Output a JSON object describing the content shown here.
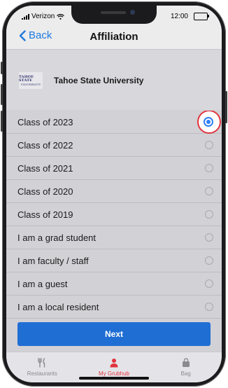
{
  "status_bar": {
    "carrier": "Verizon",
    "time": "12:00"
  },
  "nav": {
    "back_label": "Back",
    "title": "Affiliation"
  },
  "school": {
    "logo_line1": "TAHOE STATE",
    "logo_line2": "UNIVERSITY",
    "name": "Tahoe State University"
  },
  "options": [
    {
      "label": "Class of 2023",
      "selected": true
    },
    {
      "label": "Class of 2022",
      "selected": false
    },
    {
      "label": "Class of 2021",
      "selected": false
    },
    {
      "label": "Class of 2020",
      "selected": false
    },
    {
      "label": "Class of 2019",
      "selected": false
    },
    {
      "label": "I am a grad student",
      "selected": false
    },
    {
      "label": "I am faculty / staff",
      "selected": false
    },
    {
      "label": "I am a guest",
      "selected": false
    },
    {
      "label": "I am a local resident",
      "selected": false
    }
  ],
  "footer": {
    "next_label": "Next"
  },
  "tabs": [
    {
      "label": "Restaurants",
      "icon": "fork-knife-icon",
      "active": false
    },
    {
      "label": "My Grubhub",
      "icon": "person-icon",
      "active": true
    },
    {
      "label": "Bag",
      "icon": "bag-icon",
      "active": false
    }
  ],
  "colors": {
    "accent_blue": "#1f6ed4",
    "radio_blue": "#2f7ff5",
    "brand_red": "#e1343d"
  }
}
